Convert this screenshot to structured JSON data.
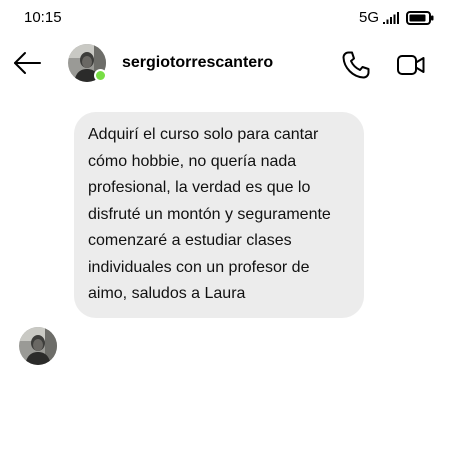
{
  "status_bar": {
    "time": "10:15",
    "network": "5G",
    "signal_icon": "signal-bars-icon",
    "battery_icon": "battery-icon"
  },
  "header": {
    "back_icon": "arrow-left-icon",
    "username": "sergiotorrescantero",
    "online": true,
    "online_color": "#78de45",
    "call_icon": "phone-icon",
    "video_icon": "video-camera-icon"
  },
  "messages": [
    {
      "sender": "sergiotorrescantero",
      "text": "Adquirí el curso solo para cantar cómo hobbie, no quería nada profesional, la verdad es que lo disfruté un montón y seguramente comenzaré a estudiar clases individuales con un profesor de aimo, saludos a Laura"
    }
  ],
  "colors": {
    "bubble_background": "#ececec",
    "background": "#ffffff",
    "text": "#111111"
  }
}
